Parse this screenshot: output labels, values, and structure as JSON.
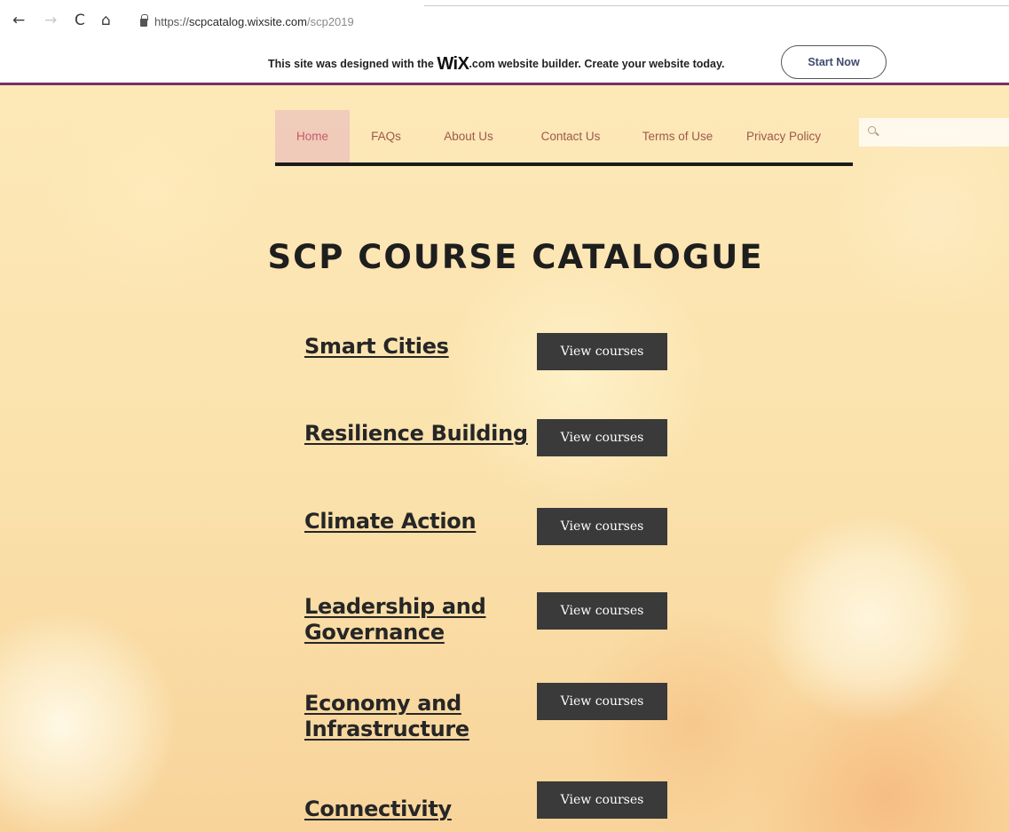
{
  "browser": {
    "back_icon": "←",
    "forward_icon": "→",
    "reload_icon": "C",
    "home_icon": "⌂",
    "url_scheme": "https://",
    "url_host": "scpcatalog.wixsite.com",
    "url_path": "/scp2019"
  },
  "wix_banner": {
    "text_before": "This site was designed with the ",
    "logo": "WiX",
    "text_after": ".com website builder. Create your website today.",
    "button_label": "Start Now"
  },
  "menu": {
    "items": [
      {
        "label": "Home",
        "active": true
      },
      {
        "label": "FAQs",
        "active": false
      },
      {
        "label": "About Us",
        "active": false
      },
      {
        "label": "Contact Us",
        "active": false
      },
      {
        "label": "Terms of Use",
        "active": false
      },
      {
        "label": "Privacy Policy",
        "active": false
      }
    ]
  },
  "page_title": "SCP COURSE CATALOGUE",
  "categories": [
    {
      "line1": "Smart Cities",
      "line2": "",
      "button": "View courses"
    },
    {
      "line1": "Resilience Building",
      "line2": "",
      "button": "View courses"
    },
    {
      "line1": "Climate Action",
      "line2": "",
      "button": "View courses"
    },
    {
      "line1": "Leadership and",
      "line2": "Governance",
      "button": "View courses"
    },
    {
      "line1": "Economy and",
      "line2": "Infrastructure",
      "button": "View courses"
    },
    {
      "line1": "Connectivity",
      "line2": "",
      "button": "View courses"
    }
  ],
  "colors": {
    "banner_rule": "#7a2f62",
    "button_bg": "#3a3a3a",
    "menu_text": "#9b5a4a",
    "menu_active": "#c45a6a"
  }
}
